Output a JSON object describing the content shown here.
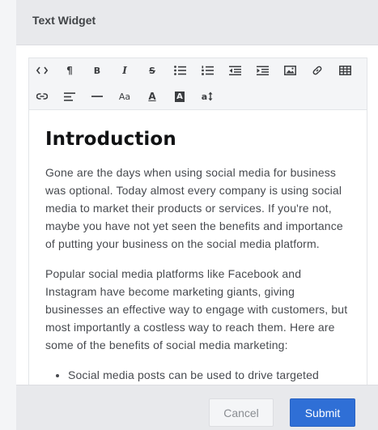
{
  "panel": {
    "title": "Text Widget"
  },
  "toolbar": {
    "row1": [
      {
        "icon": "code-view-icon"
      },
      {
        "icon": "paragraph-icon",
        "glyph": "¶"
      },
      {
        "icon": "bold-icon",
        "glyph": "B"
      },
      {
        "icon": "italic-icon",
        "glyph": "I"
      },
      {
        "icon": "strikethrough-icon",
        "glyph": "S"
      },
      {
        "icon": "bulleted-list-icon"
      },
      {
        "icon": "numbered-list-icon"
      },
      {
        "icon": "outdent-icon"
      },
      {
        "icon": "indent-icon"
      },
      {
        "icon": "insert-image-icon"
      },
      {
        "icon": "insert-link-icon"
      },
      {
        "icon": "insert-table-icon"
      }
    ],
    "row2": [
      {
        "icon": "link-icon"
      },
      {
        "icon": "align-icon"
      },
      {
        "icon": "horizontal-line-icon"
      },
      {
        "icon": "font-size-icon",
        "glyph": "Aa"
      },
      {
        "icon": "text-color-icon",
        "glyph": "A"
      },
      {
        "icon": "background-color-icon",
        "glyph": "A"
      },
      {
        "icon": "line-height-icon",
        "glyph": "a"
      }
    ]
  },
  "content": {
    "heading": "Introduction",
    "paragraph1": "Gone are the days when using social media for business was optional. Today almost every company is using social media to market their products or services. If you're not, maybe you have not yet seen the benefits and importance of putting your business on the social media platform.",
    "paragraph2": "Popular social media platforms like Facebook and Instagram have become marketing giants, giving businesses an effective way to engage with customers, but most importantly a costless way to reach them. Here are some of the benefits of social media marketing:",
    "bullets": [
      "Social media posts can be used to drive targeted"
    ]
  },
  "footer": {
    "cancel_label": "Cancel",
    "submit_label": "Submit"
  },
  "colors": {
    "submit": "#2f6fd6",
    "header_bg": "#e8e9ec"
  }
}
